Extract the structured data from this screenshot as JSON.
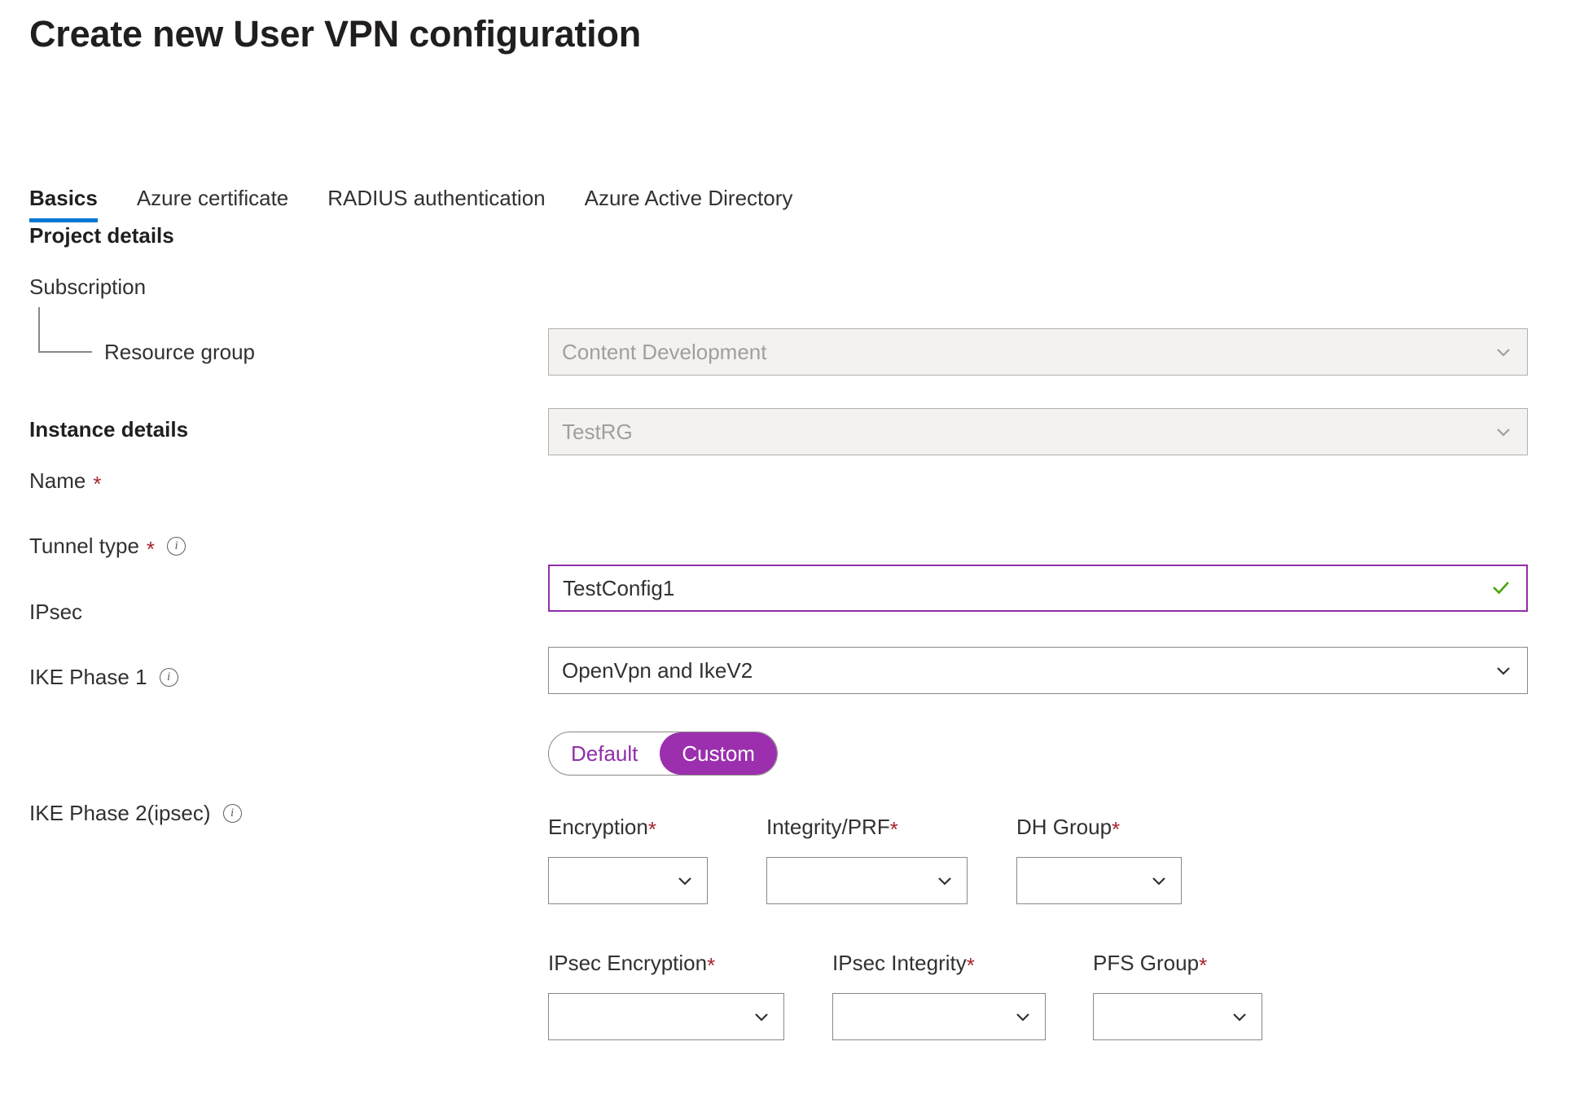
{
  "header": {
    "title": "Create new User VPN configuration"
  },
  "tabs": [
    {
      "label": "Basics",
      "active": true
    },
    {
      "label": "Azure certificate",
      "active": false
    },
    {
      "label": "RADIUS authentication",
      "active": false
    },
    {
      "label": "Azure Active Directory",
      "active": false
    }
  ],
  "sections": {
    "project": {
      "title": "Project details"
    },
    "instance": {
      "title": "Instance details"
    }
  },
  "fields": {
    "subscription": {
      "label": "Subscription",
      "value": "Content Development",
      "state": "disabled"
    },
    "resource_group": {
      "label": "Resource group",
      "value": "TestRG",
      "state": "disabled"
    },
    "name": {
      "label": "Name",
      "required": "*",
      "value": "TestConfig1",
      "state": "valid",
      "validation_icon": "checkmark-icon"
    },
    "tunnel_type": {
      "label": "Tunnel type",
      "required": "*",
      "info_icon": "info-icon",
      "value": "OpenVpn and IkeV2"
    },
    "ipsec": {
      "label": "IPsec",
      "options": [
        {
          "label": "Default",
          "selected": false
        },
        {
          "label": "Custom",
          "selected": true
        }
      ]
    },
    "ike_phase_1": {
      "label": "IKE Phase 1",
      "info_icon": "info-icon",
      "subfields": [
        {
          "label": "Encryption",
          "required": "*",
          "value": ""
        },
        {
          "label": "Integrity/PRF",
          "required": "*",
          "value": ""
        },
        {
          "label": "DH Group",
          "required": "*",
          "value": ""
        }
      ]
    },
    "ike_phase_2": {
      "label": "IKE Phase 2(ipsec)",
      "info_icon": "info-icon",
      "subfields": [
        {
          "label": "IPsec Encryption",
          "required": "*",
          "value": ""
        },
        {
          "label": "IPsec Integrity",
          "required": "*",
          "value": ""
        },
        {
          "label": "PFS Group",
          "required": "*",
          "value": ""
        }
      ]
    }
  },
  "icons": {
    "info": "i",
    "chevron_down": "chevron-down-icon",
    "check": "checkmark-icon"
  },
  "colors": {
    "accent_tab": "#0078d4",
    "focus_purple": "#8f2fa8",
    "toggle_selected": "#9b2fae",
    "required_red": "#a4262c",
    "valid_green": "#4ca20a",
    "disabled_bg": "#f3f2f1"
  }
}
